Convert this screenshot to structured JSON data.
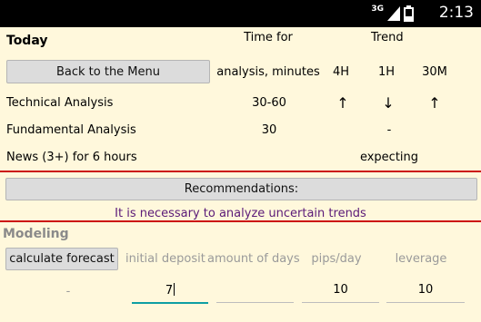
{
  "status_bar": {
    "network_label": "3G",
    "signal_icon": "signal-bars-icon",
    "battery_icon": "battery-icon",
    "time": "2:13"
  },
  "today": {
    "title": "Today",
    "back_button": "Back to the Menu",
    "time_header_line1": "Time for",
    "time_header_line2": "analysis, minutes",
    "trend_header": "Trend",
    "columns": [
      "4H",
      "1H",
      "30M"
    ],
    "rows": [
      {
        "label": "Technical Analysis",
        "time": "30-60",
        "trends": [
          "↑",
          "↓",
          "↑"
        ]
      },
      {
        "label": "Fundamental Analysis",
        "time": "30",
        "trend": "-"
      },
      {
        "label": "News (3+) for 6 hours",
        "trend": "expecting"
      }
    ]
  },
  "recommendations": {
    "button": "Recommendations:",
    "message": "It is necessary to analyze uncertain trends"
  },
  "modeling": {
    "title": "Modeling",
    "calculate_button": "calculate forecast",
    "result": "-",
    "fields": [
      {
        "placeholder": "initial deposit",
        "value": "7"
      },
      {
        "placeholder": "amount of days",
        "value": ""
      },
      {
        "placeholder": "pips/day",
        "value": "10"
      },
      {
        "placeholder": "leverage",
        "value": "10"
      }
    ]
  },
  "colors": {
    "background": "#fff8dc",
    "divider": "#cc1111",
    "message": "#5a1a78",
    "hint": "#9a9a9a",
    "focus_underline": "#0e9ea3"
  }
}
